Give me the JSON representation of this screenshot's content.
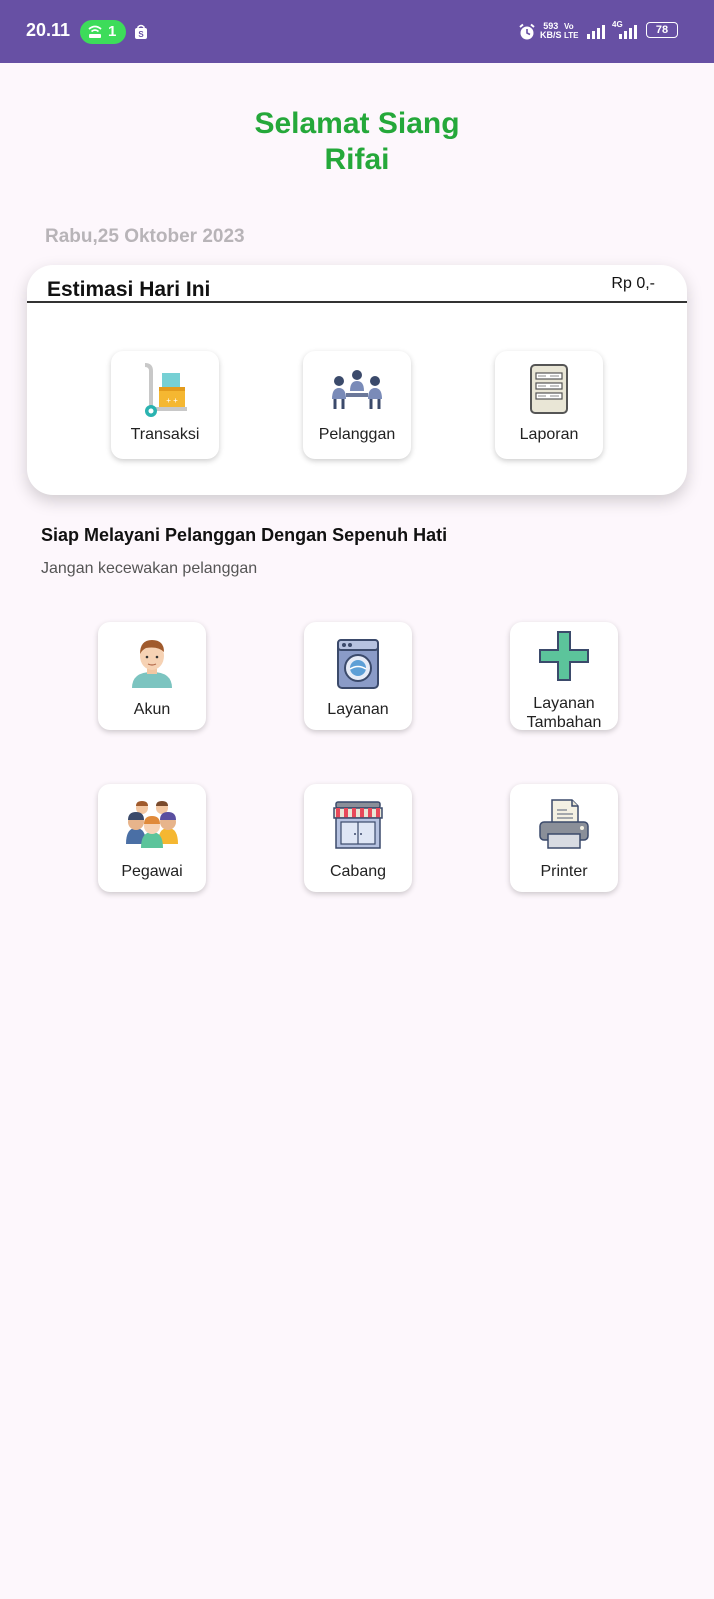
{
  "status_bar": {
    "time": "20.11",
    "hotspot_count": "1",
    "net_speed": "593",
    "net_speed_unit": "KB/S",
    "network_type": "4G",
    "battery": "78",
    "background_color": "#6750a4"
  },
  "greeting": {
    "line1": "Selamat Siang",
    "line2": "Rifai",
    "color": "#25a83a"
  },
  "date": "Rabu,25 Oktober 2023",
  "estimate_card": {
    "title": "Estimasi Hari Ini",
    "amount": "Rp 0,-",
    "actions": [
      {
        "label": "Transaksi",
        "icon": "delivery-cart-icon"
      },
      {
        "label": "Pelanggan",
        "icon": "customers-meeting-icon"
      },
      {
        "label": "Laporan",
        "icon": "report-document-icon"
      }
    ]
  },
  "service_section": {
    "title": "Siap Melayani Pelanggan Dengan Sepenuh Hati",
    "subtitle": "Jangan kecewakan pelanggan"
  },
  "menu": [
    {
      "label": "Akun",
      "icon": "user-avatar-icon"
    },
    {
      "label": "Layanan",
      "icon": "washing-machine-icon"
    },
    {
      "label": "Layanan Tambahan",
      "icon": "plus-icon"
    },
    {
      "label": "Pegawai",
      "icon": "employees-group-icon"
    },
    {
      "label": "Cabang",
      "icon": "storefront-icon"
    },
    {
      "label": "Printer",
      "icon": "printer-icon"
    }
  ]
}
